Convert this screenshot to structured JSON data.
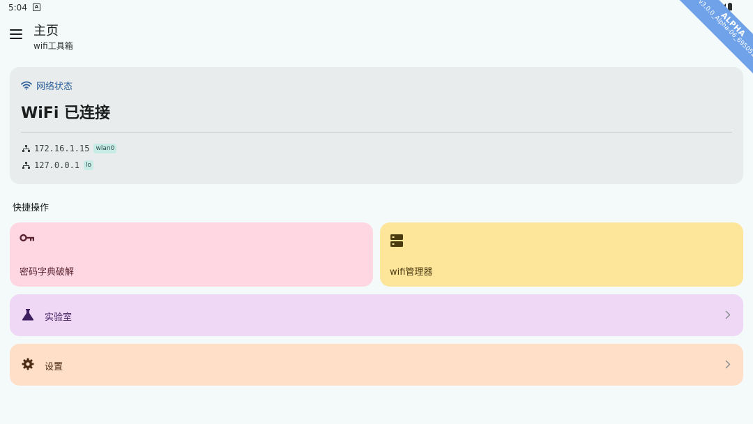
{
  "status_bar": {
    "time": "5:04",
    "notification_glyph": "A"
  },
  "debug_banner": {
    "line1": "ALPHA",
    "line2": "v3.0.0_Alpha-06_695051a"
  },
  "app_bar": {
    "title": "主页",
    "subtitle": "wifi工具箱"
  },
  "network_card": {
    "header": "网络状态",
    "status": "WiFi 已连接",
    "addresses": [
      {
        "ip": "172.16.1.15",
        "iface": "wlan0"
      },
      {
        "ip": "127.0.0.1",
        "iface": "lo"
      }
    ]
  },
  "quick_actions": {
    "label": "快捷操作",
    "crack": {
      "label": "密码字典破解",
      "icon": "key-icon"
    },
    "wifi_manager": {
      "label": "wifi管理器",
      "icon": "storage-icon"
    },
    "lab": {
      "label": "实验室",
      "icon": "flask-icon"
    },
    "settings": {
      "label": "设置",
      "icon": "gear-icon"
    }
  },
  "colors": {
    "background": "#f3faf9",
    "accent": "#2d5f9a",
    "crack_tile": "#ffd7e2",
    "wifi_manager_tile": "#fde59a",
    "lab_tile": "#efd8f6",
    "settings_tile": "#ffdfc8",
    "banner": "#6fa2e8"
  }
}
